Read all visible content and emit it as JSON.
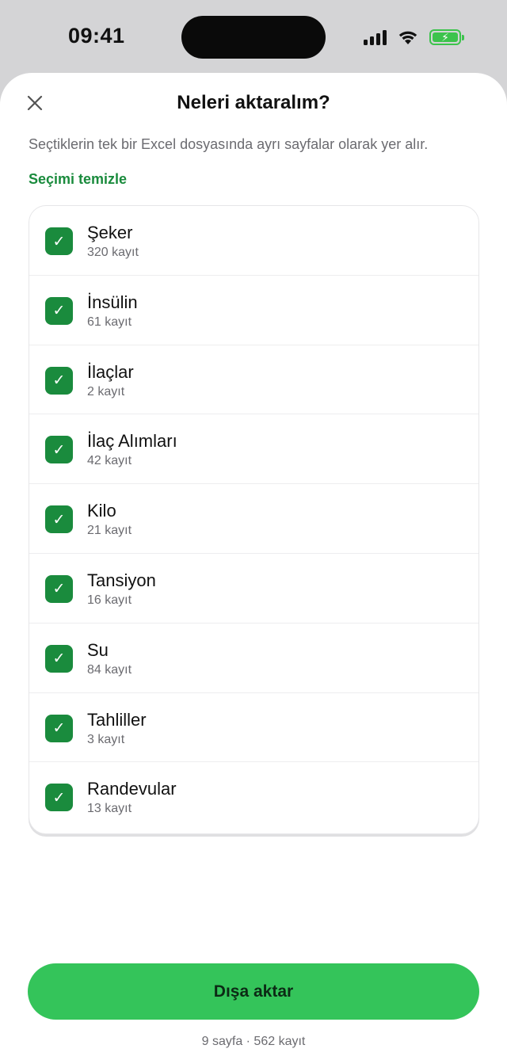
{
  "status": {
    "time": "09:41"
  },
  "sheet": {
    "title": "Neleri aktaralım?",
    "subtitle": "Seçtiklerin tek bir Excel dosyasında ayrı sayfalar olarak yer alır.",
    "clear_label": "Seçimi temizle"
  },
  "items": [
    {
      "name": "Şeker",
      "count": "320 kayıt",
      "checked": true
    },
    {
      "name": "İnsülin",
      "count": "61 kayıt",
      "checked": true
    },
    {
      "name": "İlaçlar",
      "count": "2 kayıt",
      "checked": true
    },
    {
      "name": "İlaç Alımları",
      "count": "42 kayıt",
      "checked": true
    },
    {
      "name": "Kilo",
      "count": "21 kayıt",
      "checked": true
    },
    {
      "name": "Tansiyon",
      "count": "16 kayıt",
      "checked": true
    },
    {
      "name": "Su",
      "count": "84 kayıt",
      "checked": true
    },
    {
      "name": "Tahliller",
      "count": "3 kayıt",
      "checked": true
    },
    {
      "name": "Randevular",
      "count": "13 kayıt",
      "checked": true
    }
  ],
  "footer": {
    "export_label": "Dışa aktar",
    "summary": "9 sayfa · 562 kayıt"
  },
  "icons": {
    "close": "close-icon",
    "check": "check-icon",
    "signal": "cellular-signal-icon",
    "wifi": "wifi-icon",
    "battery": "battery-charging-icon"
  },
  "colors": {
    "accent_green": "#1a8b3d",
    "button_green": "#34c45a",
    "battery_green": "#3cc34c"
  }
}
